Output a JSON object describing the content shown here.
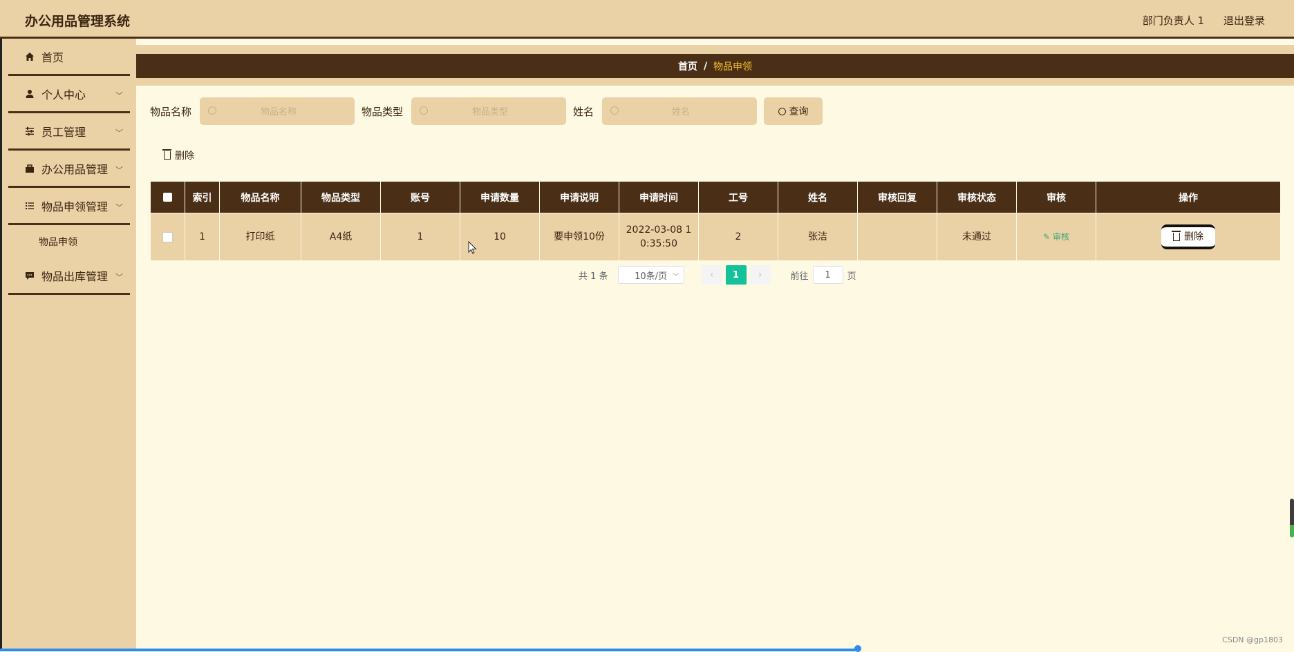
{
  "header": {
    "title": "办公用品管理系统",
    "user": "部门负责人 1",
    "logout": "退出登录"
  },
  "sidebar": {
    "items": [
      {
        "label": "首页",
        "icon": "home-icon"
      },
      {
        "label": "个人中心",
        "icon": "user-icon"
      },
      {
        "label": "员工管理",
        "icon": "sliders-icon"
      },
      {
        "label": "办公用品管理",
        "icon": "briefcase-icon"
      },
      {
        "label": "物品申领管理",
        "icon": "list-icon"
      },
      {
        "label": "物品出库管理",
        "icon": "chat-icon"
      }
    ],
    "submenu": {
      "label": "物品申领"
    }
  },
  "breadcrumb": {
    "home": "首页",
    "separator": "/",
    "current": "物品申领"
  },
  "search": {
    "fields": [
      {
        "label": "物品名称",
        "placeholder": "物品名称"
      },
      {
        "label": "物品类型",
        "placeholder": "物品类型"
      },
      {
        "label": "姓名",
        "placeholder": "姓名"
      }
    ],
    "query_label": "查询"
  },
  "actions": {
    "delete_label": "删除"
  },
  "table": {
    "columns": [
      "索引",
      "物品名称",
      "物品类型",
      "账号",
      "申请数量",
      "申请说明",
      "申请时间",
      "工号",
      "姓名",
      "审核回复",
      "审核状态",
      "审核",
      "操作"
    ],
    "rows": [
      {
        "index": "1",
        "item_name": "打印纸",
        "item_type": "A4纸",
        "account": "1",
        "quantity": "10",
        "description": "要申领10份",
        "time_line1": "2022-03-08 1",
        "time_line2": "0:35:50",
        "employee_no": "2",
        "name": "张洁",
        "reply": "",
        "status": "未通过",
        "audit_label": "审核",
        "delete_label": "删除"
      }
    ]
  },
  "pagination": {
    "total": "共 1 条",
    "page_size": "10条/页",
    "current_page": "1",
    "goto_label": "前往",
    "goto_value": "1",
    "page_suffix": "页"
  },
  "watermark": "CSDN @gp1803",
  "colors": {
    "header_bg": "#ebd1a6",
    "dark_brown": "#4a2f16",
    "page_bg": "#fdf9e3",
    "breadcrumb_current": "#f2c12e",
    "pagination_active": "#13c29a",
    "audit_link": "#3aaa7a"
  }
}
